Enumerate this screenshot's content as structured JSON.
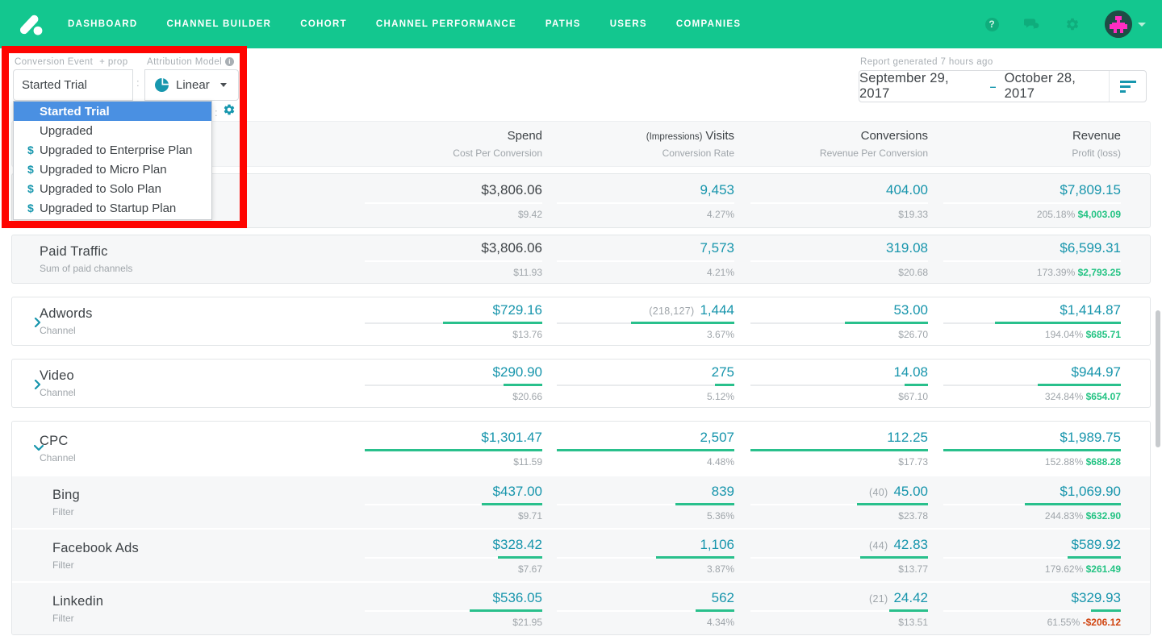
{
  "nav": {
    "brand": "attribution-logo",
    "items": [
      "DASHBOARD",
      "CHANNEL BUILDER",
      "COHORT",
      "CHANNEL PERFORMANCE",
      "PATHS",
      "USERS",
      "COMPANIES"
    ],
    "help_glyph": "?"
  },
  "filters": {
    "conversion_event": {
      "label": "Conversion Event",
      "prop_link": "+ prop",
      "value": "Started Trial"
    },
    "separator": ":",
    "attribution_model": {
      "label": "Attribution Model",
      "value": "Linear"
    },
    "dropdown": {
      "items": [
        {
          "label": "Started Trial",
          "selected": true,
          "paid": false
        },
        {
          "label": "Upgraded",
          "selected": false,
          "paid": false
        },
        {
          "label": "Upgraded to Enterprise Plan",
          "selected": false,
          "paid": true
        },
        {
          "label": "Upgraded to Micro Plan",
          "selected": false,
          "paid": true
        },
        {
          "label": "Upgraded to Solo Plan",
          "selected": false,
          "paid": true
        },
        {
          "label": "Upgraded to Startup Plan",
          "selected": false,
          "paid": true
        }
      ],
      "dollar_glyph": "$"
    }
  },
  "report": {
    "generated": "Report generated 7 hours ago",
    "date_start": "September 29, 2017",
    "range_separator": "–",
    "date_end": "October 28, 2017"
  },
  "table": {
    "columns": [
      {
        "title": "Spend",
        "sub": "Cost Per Conversion"
      },
      {
        "title_prefix": "(Impressions)",
        "title": "Visits",
        "sub": "Conversion Rate"
      },
      {
        "title": "Conversions",
        "sub": "Revenue Per Conversion"
      },
      {
        "title": "Revenue",
        "sub": "Profit (loss)"
      }
    ],
    "rows": [
      {
        "name": "",
        "subtitle": "",
        "spend": {
          "value": "$3,806.06",
          "sub": "$9.42",
          "bar": 0
        },
        "visits": {
          "value": "9,453",
          "sub": "4.27%",
          "bar": 0
        },
        "conversions": {
          "value": "404.00",
          "sub": "$19.33",
          "bar": 0
        },
        "revenue": {
          "value": "$7,809.15",
          "sub_pct": "205.18%",
          "profit": "$4,003.09",
          "bar": 0
        }
      },
      {
        "name": "Paid Traffic",
        "subtitle": "Sum of paid channels",
        "spend": {
          "value": "$3,806.06",
          "sub": "$11.93",
          "bar": 0
        },
        "visits": {
          "value": "7,573",
          "sub": "4.21%",
          "bar": 0
        },
        "conversions": {
          "value": "319.08",
          "sub": "$20.68",
          "bar": 0
        },
        "revenue": {
          "value": "$6,599.31",
          "sub_pct": "173.39%",
          "profit": "$2,793.25",
          "bar": 0
        }
      },
      {
        "name": "Adwords",
        "subtitle": "Channel",
        "spend": {
          "value": "$729.16",
          "sub": "$13.76",
          "bar": 56
        },
        "visits": {
          "prefix": "(218,127)",
          "value": "1,444",
          "sub": "3.67%",
          "bar": 58
        },
        "conversions": {
          "value": "53.00",
          "sub": "$26.70",
          "bar": 47
        },
        "revenue": {
          "value": "$1,414.87",
          "sub_pct": "194.04%",
          "profit": "$685.71",
          "bar": 71
        }
      },
      {
        "name": "Video",
        "subtitle": "Channel",
        "spend": {
          "value": "$290.90",
          "sub": "$20.66",
          "bar": 22
        },
        "visits": {
          "value": "275",
          "sub": "5.12%",
          "bar": 11
        },
        "conversions": {
          "value": "14.08",
          "sub": "$67.10",
          "bar": 13
        },
        "revenue": {
          "value": "$944.97",
          "sub_pct": "324.84%",
          "profit": "$654.07",
          "bar": 47
        }
      },
      {
        "name": "CPC",
        "subtitle": "Channel",
        "spend": {
          "value": "$1,301.47",
          "sub": "$11.59",
          "bar": 100
        },
        "visits": {
          "value": "2,507",
          "sub": "4.48%",
          "bar": 100
        },
        "conversions": {
          "value": "112.25",
          "sub": "$17.73",
          "bar": 100
        },
        "revenue": {
          "value": "$1,989.75",
          "sub_pct": "152.88%",
          "profit": "$688.28",
          "bar": 100
        }
      },
      {
        "name": "Bing",
        "subtitle": "Filter",
        "spend": {
          "value": "$437.00",
          "sub": "$9.71",
          "bar": 34
        },
        "visits": {
          "value": "839",
          "sub": "5.36%",
          "bar": 33
        },
        "conversions": {
          "prefix": "(40)",
          "value": "45.00",
          "sub": "$23.78",
          "bar": 40
        },
        "revenue": {
          "value": "$1,069.90",
          "sub_pct": "244.83%",
          "profit": "$632.90",
          "bar": 54
        }
      },
      {
        "name": "Facebook Ads",
        "subtitle": "Filter",
        "spend": {
          "value": "$328.42",
          "sub": "$7.67",
          "bar": 25
        },
        "visits": {
          "value": "1,106",
          "sub": "3.87%",
          "bar": 44
        },
        "conversions": {
          "prefix": "(44)",
          "value": "42.83",
          "sub": "$13.77",
          "bar": 38
        },
        "revenue": {
          "value": "$589.92",
          "sub_pct": "179.62%",
          "profit": "$261.49",
          "bar": 30
        }
      },
      {
        "name": "Linkedin",
        "subtitle": "Filter",
        "spend": {
          "value": "$536.05",
          "sub": "$21.95",
          "bar": 41
        },
        "visits": {
          "value": "562",
          "sub": "4.34%",
          "bar": 22
        },
        "conversions": {
          "prefix": "(21)",
          "value": "24.42",
          "sub": "$13.51",
          "bar": 22
        },
        "revenue": {
          "value": "$329.93",
          "sub_pct": "61.55%",
          "profit": "-$206.12",
          "bar": 17
        }
      }
    ]
  },
  "colors": {
    "brand_green": "#13C78F",
    "metric_teal": "#1795AC",
    "bar_green": "#29C08C",
    "profit_green": "#23C383",
    "loss_red": "#D0430F",
    "selected_blue": "#4A90E2",
    "annotation_red": "#FE0400"
  }
}
